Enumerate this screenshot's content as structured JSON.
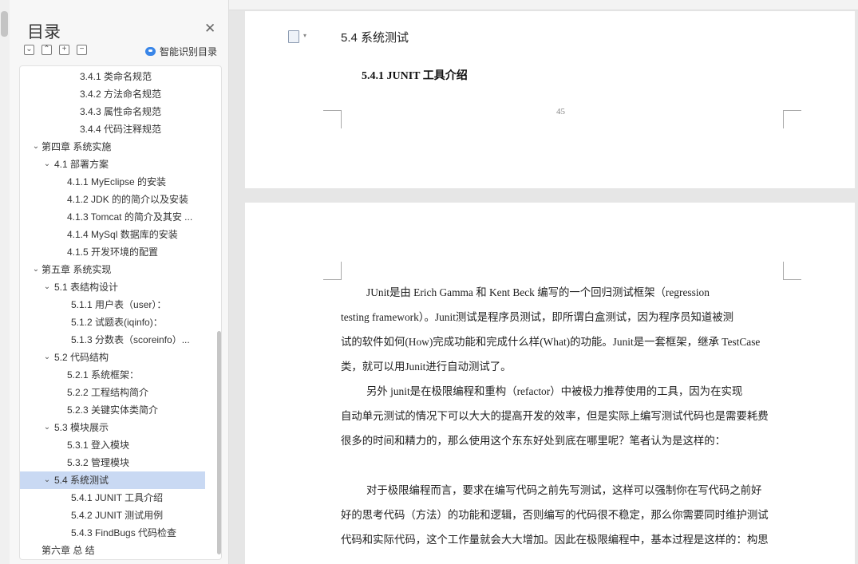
{
  "toc": {
    "title": "目录",
    "close_icon": "close-icon",
    "smart_label": "智能识别目录",
    "tools": [
      "collapse-all-icon",
      "expand-level-icon",
      "add-item-icon",
      "remove-item-icon"
    ],
    "items": [
      {
        "label": "3.4.1  类命名规范",
        "level": 3,
        "chev": ""
      },
      {
        "label": "3.4.2  方法命名规范",
        "level": 3,
        "chev": ""
      },
      {
        "label": "3.4.3  属性命名规范",
        "level": 3,
        "chev": ""
      },
      {
        "label": "3.4.4  代码注释规范",
        "level": 3,
        "chev": ""
      },
      {
        "label": "第四章  系统实施",
        "level": 1,
        "chev": "v"
      },
      {
        "label": "4.1 部署方案",
        "level": 2,
        "chev": "v"
      },
      {
        "label": "4.1.1 MyEclipse 的安装",
        "level": 2.5,
        "chev": ""
      },
      {
        "label": "4.1.2 JDK 的的简介以及安装",
        "level": 2.5,
        "chev": ""
      },
      {
        "label": "4.1.3 Tomcat 的简介及其安 ...",
        "level": 2.5,
        "chev": ""
      },
      {
        "label": "4.1.4 MySql 数据库的安装",
        "level": 2.5,
        "chev": ""
      },
      {
        "label": "4.1.5  开发环境的配置",
        "level": 2.5,
        "chev": ""
      },
      {
        "label": "第五章    系统实现",
        "level": 1,
        "chev": "v"
      },
      {
        "label": "5.1  表结构设计",
        "level": 2,
        "chev": "v"
      },
      {
        "label": "5.1.1  用户表（user）：",
        "level": 2.7,
        "chev": ""
      },
      {
        "label": "5.1.2  试题表(iqinfo)：",
        "level": 2.7,
        "chev": ""
      },
      {
        "label": "5.1.3  分数表（scoreinfo）...",
        "level": 2.7,
        "chev": ""
      },
      {
        "label": "5.2 代码结构",
        "level": 2,
        "chev": "v"
      },
      {
        "label": "5.2.1 系统框架：",
        "level": 2.5,
        "chev": ""
      },
      {
        "label": "5.2.2 工程结构简介",
        "level": 2.5,
        "chev": ""
      },
      {
        "label": "5.2.3  关键实体类简介",
        "level": 2.5,
        "chev": ""
      },
      {
        "label": "5.3 模块展示",
        "level": 2,
        "chev": "v"
      },
      {
        "label": "5.3.1 登入模块",
        "level": 2.5,
        "chev": ""
      },
      {
        "label": "5.3.2 管理模块",
        "level": 2.5,
        "chev": ""
      },
      {
        "label": "5.4  系统测试",
        "level": 2,
        "chev": "v",
        "selected": true
      },
      {
        "label": "5.4.1 JUNIT 工具介绍",
        "level": 2.7,
        "chev": ""
      },
      {
        "label": "5.4.2 JUNIT 测试用例",
        "level": 2.7,
        "chev": ""
      },
      {
        "label": "5.4.3 FindBugs 代码检查",
        "level": 2.7,
        "chev": ""
      },
      {
        "label": "第六章    总    结",
        "level": 1,
        "chev": ""
      }
    ]
  },
  "doc": {
    "page1": {
      "section_title": "5.4  系统测试",
      "sub_title": "5.4.1 JUNIT 工具介绍",
      "page_number": "45"
    },
    "page2": {
      "lines": [
        {
          "text": "JUnit是由 Erich Gamma 和 Kent Beck 编写的一个回归测试框架（regression",
          "indent": true
        },
        {
          "text": "testing framework）。Junit测试是程序员测试，即所谓白盒测试，因为程序员知道被测",
          "indent": false
        },
        {
          "text": "试的软件如何(How)完成功能和完成什么样(What)的功能。Junit是一套框架，继承 TestCase",
          "indent": false
        },
        {
          "text": "类，就可以用Junit进行自动测试了。",
          "indent": false
        },
        {
          "text": "另外 junit是在极限编程和重构（refactor）中被极力推荐使用的工具，因为在实现",
          "indent": true
        },
        {
          "text": "自动单元测试的情况下可以大大的提高开发的效率，但是实际上编写测试代码也是需要耗费",
          "indent": false
        },
        {
          "text": "很多的时间和精力的，那么使用这个东东好处到底在哪里呢？笔者认为是这样的：",
          "indent": false
        },
        {
          "text": "",
          "indent": false
        },
        {
          "text": "对于极限编程而言，要求在编写代码之前先写测试，这样可以强制你在写代码之前好",
          "indent": true
        },
        {
          "text": "好的思考代码（方法）的功能和逻辑，否则编写的代码很不稳定，那么你需要同时维护测试",
          "indent": false
        },
        {
          "text": "代码和实际代码，这个工作量就会大大增加。因此在极限编程中，基本过程是这样的：构思",
          "indent": false
        }
      ]
    }
  }
}
